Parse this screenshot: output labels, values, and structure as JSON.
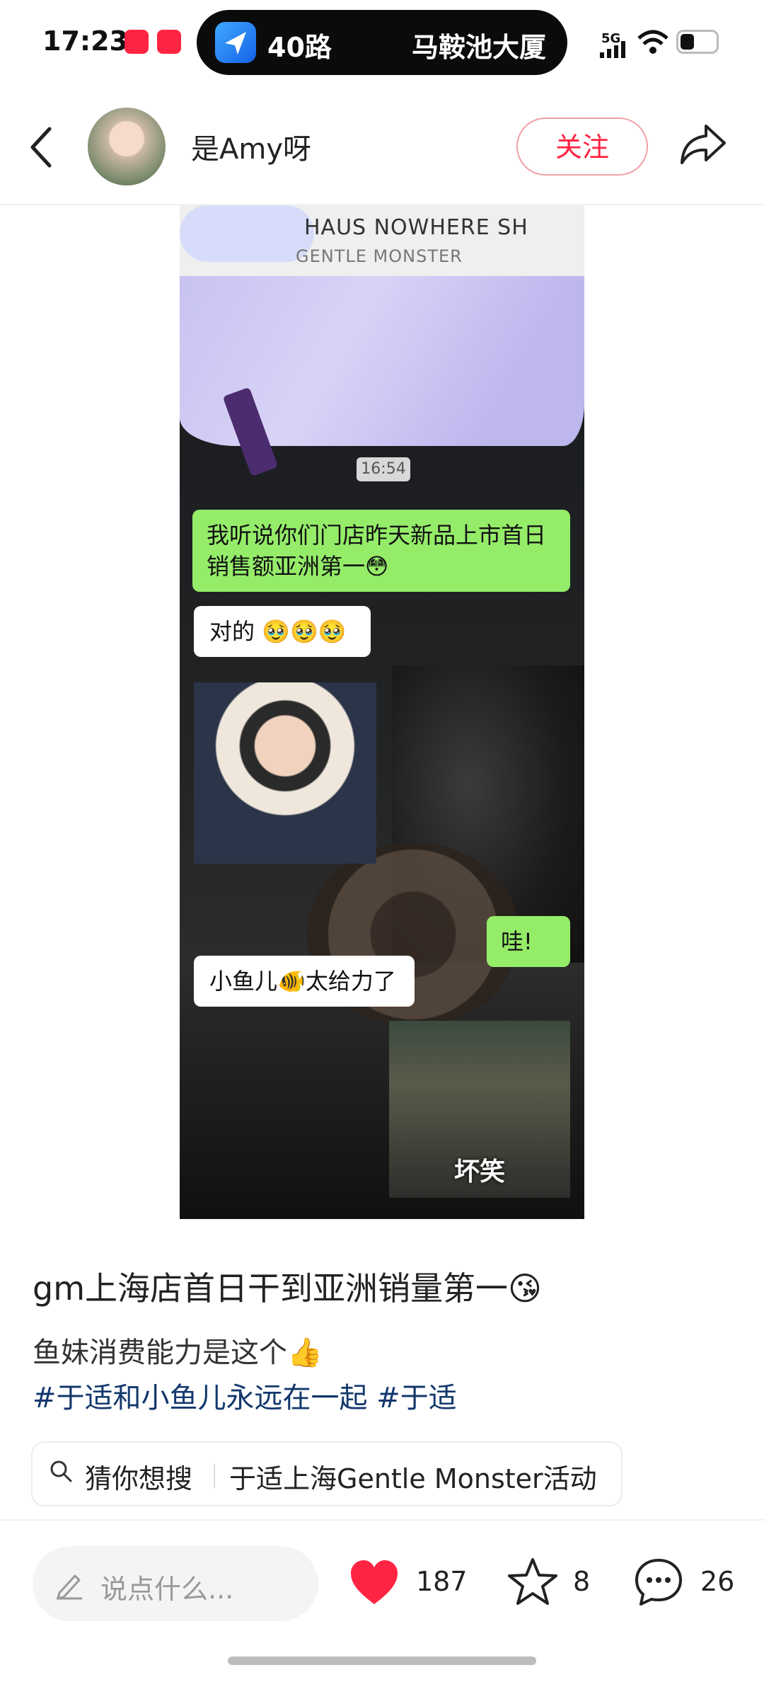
{
  "status_bar": {
    "time": "17:23",
    "island_route": "40路",
    "island_destination": "马鞍池大厦",
    "network": "5G",
    "battery_level": 0.35
  },
  "header": {
    "username": "是Amy呀",
    "follow_label": "关注"
  },
  "image": {
    "store_name": "HAUS NOWHERE SH",
    "store_brand": "GENTLE MONSTER",
    "chat_time": "16:54",
    "messages": [
      {
        "side": "right",
        "text": "我听说你们门店昨天新品上市首日销售额亚洲第一😳"
      },
      {
        "side": "left",
        "text": "对的 🥹🥹🥹"
      },
      {
        "side": "right",
        "text": "哇!"
      },
      {
        "side": "left",
        "text": "小鱼儿🐠太给力了"
      }
    ],
    "sticker_caption": "坏笑"
  },
  "post": {
    "title": "gm上海店首日干到亚洲销量第一😘",
    "line": "鱼妹消费能力是这个👍",
    "hashtags": "#于适和小鱼儿永远在一起 #于适",
    "search_chip_label": "猜你想搜",
    "search_chip_query": "于适上海Gentle Monster活动"
  },
  "bottom_bar": {
    "comment_placeholder": "说点什么...",
    "likes": "187",
    "collects": "8",
    "comments": "26"
  },
  "colors": {
    "accent": "#ff2442",
    "hashtag": "#13386c",
    "chat_green": "#95ec69"
  }
}
